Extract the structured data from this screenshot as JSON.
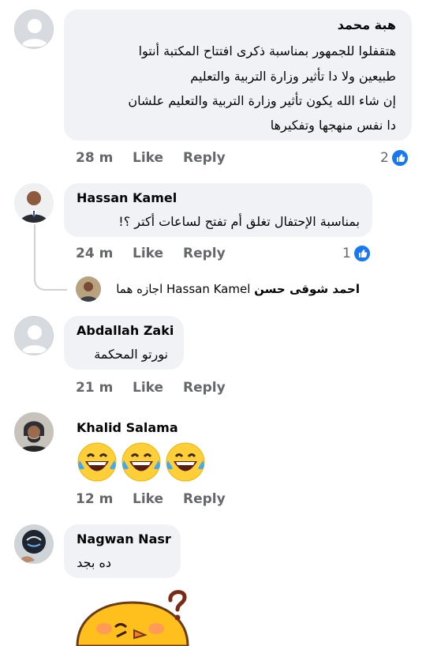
{
  "comments": [
    {
      "name": "هبة محمد",
      "lines": [
        "هتقفلوا للجمهور بمناسبة ذكرى افتتاح المكتبة أنتوا",
        "طبيعين ولا دا تأثير وزارة التربية والتعليم",
        "إن شاء الله يكون تأثير وزارة التربية والتعليم علشان",
        "دا نفس منهجها وتفكيرها"
      ],
      "time": "28 m",
      "like_label": "Like",
      "reply_label": "Reply",
      "reaction_count": "2"
    },
    {
      "name": "Hassan Kamel",
      "text": "بمناسبة الإحتفال تغلق أم تفتح لساعات أكتر ؟!",
      "time": "24 m",
      "like_label": "Like",
      "reply_label": "Reply",
      "reaction_count": "1",
      "reply_preview": {
        "author": "احمد شوقى حسن",
        "mention": "Hassan Kamel",
        "text": "اجازه هما"
      }
    },
    {
      "name": "Abdallah Zaki",
      "text": "نورتو المحكمة",
      "time": "21 m",
      "like_label": "Like",
      "reply_label": "Reply"
    },
    {
      "name": "Khalid Salama",
      "emojis": [
        "😂",
        "😂",
        "😂"
      ],
      "time": "12 m",
      "like_label": "Like",
      "reply_label": "Reply"
    },
    {
      "name": "Nagwan Nasr",
      "text": "ده بجد"
    }
  ],
  "colors": {
    "bubble": "#f0f2f5",
    "meta_text": "#65676b",
    "like_blue": "#1877f2",
    "thread_line": "#ced0d4"
  },
  "icons": [
    "default-avatar-icon",
    "like-thumb-icon",
    "sticker-confused-chick"
  ]
}
